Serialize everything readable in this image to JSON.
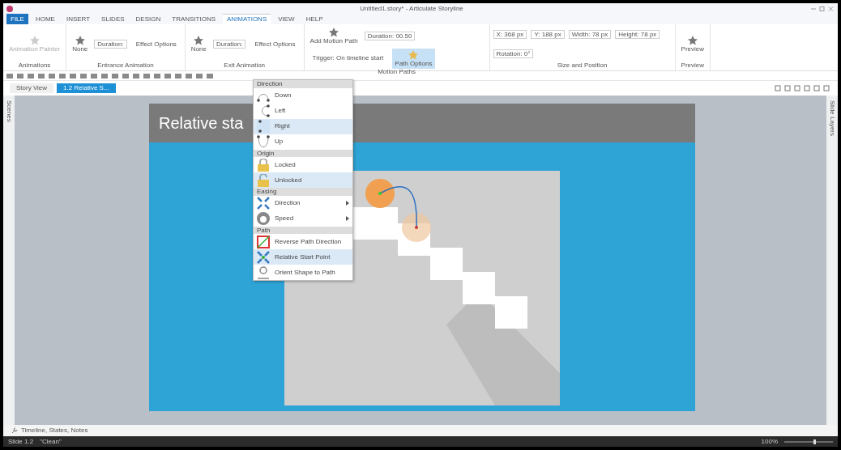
{
  "window": {
    "title": "Untitled1.story* - Articulate Storyline"
  },
  "ribbon": {
    "tabs": [
      {
        "label": "FILE",
        "selected": false,
        "kind": "file"
      },
      {
        "label": "HOME",
        "selected": false,
        "kind": "tab"
      },
      {
        "label": "INSERT",
        "selected": false,
        "kind": "tab"
      },
      {
        "label": "SLIDES",
        "selected": false,
        "kind": "tab"
      },
      {
        "label": "DESIGN",
        "selected": false,
        "kind": "tab"
      },
      {
        "label": "TRANSITIONS",
        "selected": false,
        "kind": "tab"
      },
      {
        "label": "ANIMATIONS",
        "selected": true,
        "kind": "tab"
      },
      {
        "label": "VIEW",
        "selected": false,
        "kind": "tab"
      },
      {
        "label": "HELP",
        "selected": false,
        "kind": "tab"
      }
    ],
    "groups": [
      {
        "label": "Animations",
        "items": [
          {
            "kind": "big",
            "label": "Animation Painter",
            "disabled": true
          }
        ]
      },
      {
        "label": "Entrance Animation",
        "items": [
          {
            "kind": "big",
            "label": "None",
            "disabled": false
          },
          {
            "kind": "field",
            "label": "Duration:"
          },
          {
            "kind": "small",
            "label": "Effect Options"
          }
        ]
      },
      {
        "label": "Exit Animation",
        "items": [
          {
            "kind": "big",
            "label": "None",
            "disabled": false
          },
          {
            "kind": "field",
            "label": "Duration:"
          },
          {
            "kind": "small",
            "label": "Effect Options"
          }
        ]
      },
      {
        "label": "Motion Paths",
        "items": [
          {
            "kind": "big",
            "label": "Add Motion Path",
            "disabled": false
          },
          {
            "kind": "field",
            "label": "Duration: 00.50"
          },
          {
            "kind": "small",
            "label": "Trigger: On timeline start"
          },
          {
            "kind": "active",
            "label": "Path Options"
          }
        ]
      },
      {
        "label": "Size and Position",
        "items": [
          {
            "kind": "field",
            "label": "X: 368 px"
          },
          {
            "kind": "field",
            "label": "Y: 188 px"
          },
          {
            "kind": "field",
            "label": "Width: 78 px"
          },
          {
            "kind": "field",
            "label": "Height: 78 px"
          },
          {
            "kind": "field",
            "label": "Rotation: 0°"
          }
        ]
      },
      {
        "label": "Preview",
        "items": [
          {
            "kind": "big",
            "label": "Preview",
            "disabled": false
          }
        ]
      }
    ]
  },
  "doc_tabs": [
    {
      "label": "Story View",
      "selected": false
    },
    {
      "label": "1.2 Relative S...",
      "selected": true
    }
  ],
  "left_panel": {
    "label": "Scenes"
  },
  "right_panel": {
    "label": "Slide Layers"
  },
  "slide": {
    "title": "Relative sta"
  },
  "menu": {
    "sections": [
      {
        "header": "Direction",
        "items": [
          {
            "label": "Down",
            "submenu": false,
            "selected": false
          },
          {
            "label": "Left",
            "submenu": false,
            "selected": false
          },
          {
            "label": "Right",
            "submenu": false,
            "selected": true
          },
          {
            "label": "Up",
            "submenu": false,
            "selected": false
          }
        ]
      },
      {
        "header": "Origin",
        "items": [
          {
            "label": "Locked",
            "submenu": false,
            "selected": false
          },
          {
            "label": "Unlocked",
            "submenu": false,
            "selected": true
          }
        ]
      },
      {
        "header": "Easing",
        "items": [
          {
            "label": "Direction",
            "submenu": true,
            "selected": false
          },
          {
            "label": "Speed",
            "submenu": true,
            "selected": false
          }
        ]
      },
      {
        "header": "Path",
        "items": [
          {
            "label": "Reverse Path Direction",
            "submenu": false,
            "selected": false
          },
          {
            "label": "Relative Start Point",
            "submenu": false,
            "selected": true
          },
          {
            "label": "Orient Shape to Path",
            "submenu": false,
            "selected": false
          }
        ]
      }
    ]
  },
  "timeline": {
    "label": "Timeline, States, Notes"
  },
  "status_bar": {
    "left": "Slide 1.2",
    "theme": "\"Clean\"",
    "zoom": "100%"
  }
}
